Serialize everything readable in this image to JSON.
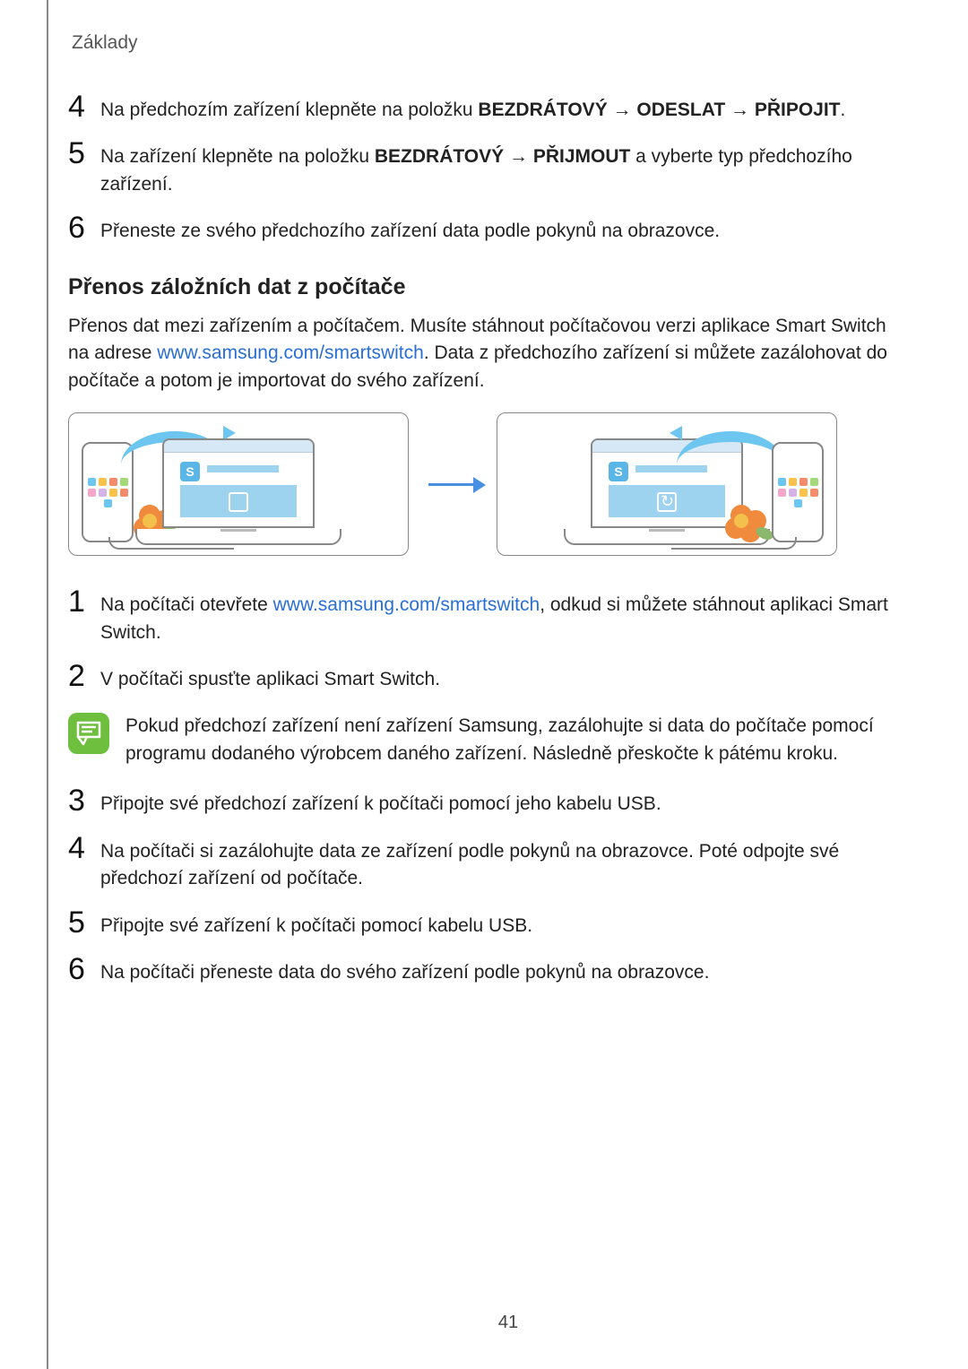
{
  "header": {
    "section": "Základy"
  },
  "steps_top": [
    {
      "num": "4",
      "pre": "Na předchozím zařízení klepněte na položku ",
      "bold": "BEZDRÁTOVÝ → ODESLAT → PŘIPOJIT",
      "post": "."
    },
    {
      "num": "5",
      "pre": "Na zařízení klepněte na položku ",
      "bold": "BEZDRÁTOVÝ → PŘIJMOUT",
      "post": " a vyberte typ předchozího zařízení."
    },
    {
      "num": "6",
      "pre": "Přeneste ze svého předchozího zařízení data podle pokynů na obrazovce.",
      "bold": "",
      "post": ""
    }
  ],
  "section2": {
    "title": "Přenos záložních dat z počítače",
    "para_pre": "Přenos dat mezi zařízením a počítačem. Musíte stáhnout počítačovou verzi aplikace Smart Switch na adrese ",
    "link": "www.samsung.com/smartswitch",
    "link_url": "www.samsung.com/smartswitch",
    "para_post": ". Data z předchozího zařízení si můžete zazálohovat do počítače a potom je importovat do svého zařízení."
  },
  "steps_pc": {
    "s1_pre": "Na počítači otevřete ",
    "s1_link": "www.samsung.com/smartswitch",
    "s1_post": ", odkud si můžete stáhnout aplikaci Smart Switch.",
    "s2": "V počítači spusťte aplikaci Smart Switch.",
    "note": "Pokud předchozí zařízení není zařízení Samsung, zazálohujte si data do počítače pomocí programu dodaného výrobcem daného zařízení. Následně přeskočte k pátému kroku.",
    "s3": "Připojte své předchozí zařízení k počítači pomocí jeho kabelu USB.",
    "s4": "Na počítači si zazálohujte data ze zařízení podle pokynů na obrazovce. Poté odpojte své předchozí zařízení od počítače.",
    "s5": "Připojte své zařízení k počítači pomocí kabelu USB.",
    "s6": "Na počítači přeneste data do svého zařízení podle pokynů na obrazovce."
  },
  "nums": {
    "n1": "1",
    "n2": "2",
    "n3": "3",
    "n4": "4",
    "n5": "5",
    "n6": "6"
  },
  "page_number": "41",
  "icons": {
    "note": "note-icon",
    "arrow": "arrow-right-icon",
    "phone": "smartphone-icon",
    "laptop": "laptop-icon"
  }
}
